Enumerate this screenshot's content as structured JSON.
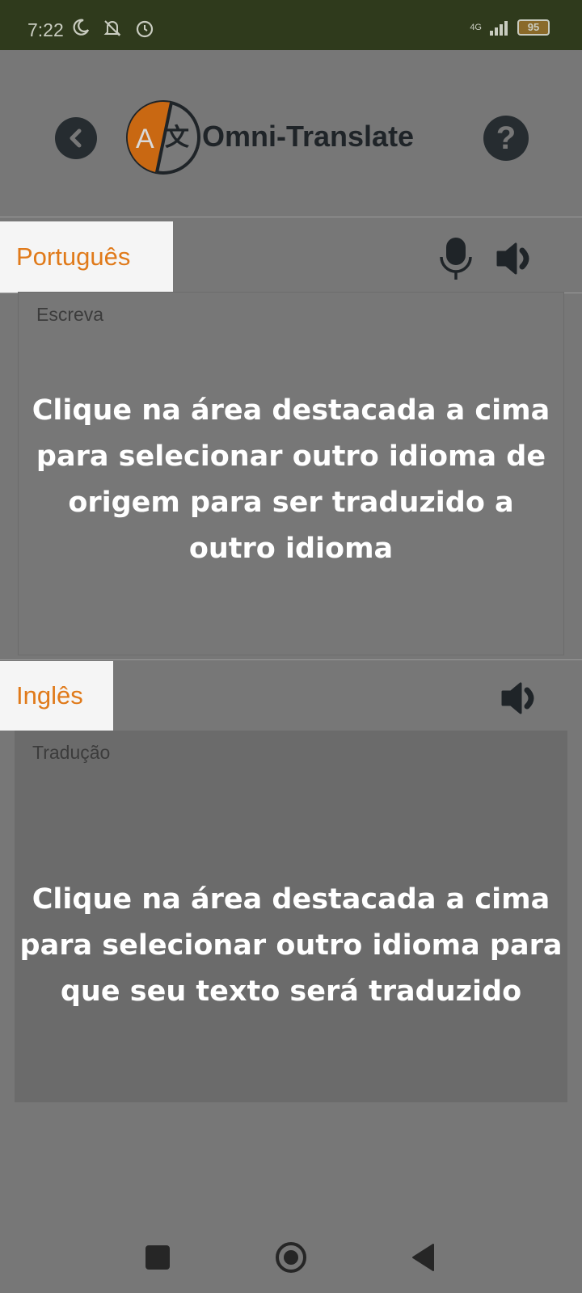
{
  "status_bar": {
    "time": "7:22",
    "network": "4G",
    "battery": "95",
    "icons": [
      "moon-icon",
      "mute-icon",
      "alarm-icon",
      "signal-icon",
      "battery-icon"
    ]
  },
  "header": {
    "app_title": "Omni-Translate",
    "logo_letters": "A文",
    "help_label": "?",
    "icons": [
      "back-icon",
      "app-logo",
      "help-icon"
    ]
  },
  "source": {
    "language": "Português",
    "placeholder": "Escreva",
    "hint": "Clique na área destacada a cima para selecionar outro idioma de origem para ser traduzido a outro idioma",
    "hint_lines": [
      "Clique na área destacada a cima",
      "para selecionar outro idioma de",
      "origem para ser traduzido a",
      "outro idioma"
    ],
    "icons": [
      "microphone-icon",
      "speaker-icon"
    ]
  },
  "target": {
    "language": "Inglês",
    "placeholder": "Tradução",
    "hint_lines": [
      "Clique na área destacada a cima",
      "para selecionar outro idioma para",
      "que seu texto será traduzido"
    ],
    "icons": [
      "speaker-icon"
    ]
  },
  "colors": {
    "accent": "#e07a1a",
    "overlay": "#777777",
    "status_bar": "#2f3a1c",
    "icon_dark": "#262c30"
  }
}
